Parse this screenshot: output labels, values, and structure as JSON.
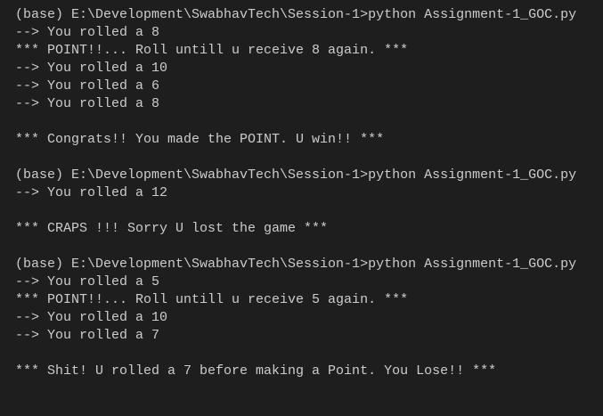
{
  "terminal": {
    "background": "#1e1e1e",
    "foreground": "#cccccc",
    "lines": [
      "(base) E:\\Development\\SwabhavTech\\Session-1>python Assignment-1_GOC.py",
      "--> You rolled a 8",
      "*** POINT!!... Roll untill u receive 8 again. ***",
      "--> You rolled a 10",
      "--> You rolled a 6",
      "--> You rolled a 8",
      "",
      "*** Congrats!! You made the POINT. U win!! ***",
      "",
      "(base) E:\\Development\\SwabhavTech\\Session-1>python Assignment-1_GOC.py",
      "--> You rolled a 12",
      "",
      "*** CRAPS !!! Sorry U lost the game ***",
      "",
      "(base) E:\\Development\\SwabhavTech\\Session-1>python Assignment-1_GOC.py",
      "--> You rolled a 5",
      "*** POINT!!... Roll untill u receive 5 again. ***",
      "--> You rolled a 10",
      "--> You rolled a 7",
      "",
      "*** Shit! U rolled a 7 before making a Point. You Lose!! ***",
      "",
      ""
    ]
  }
}
